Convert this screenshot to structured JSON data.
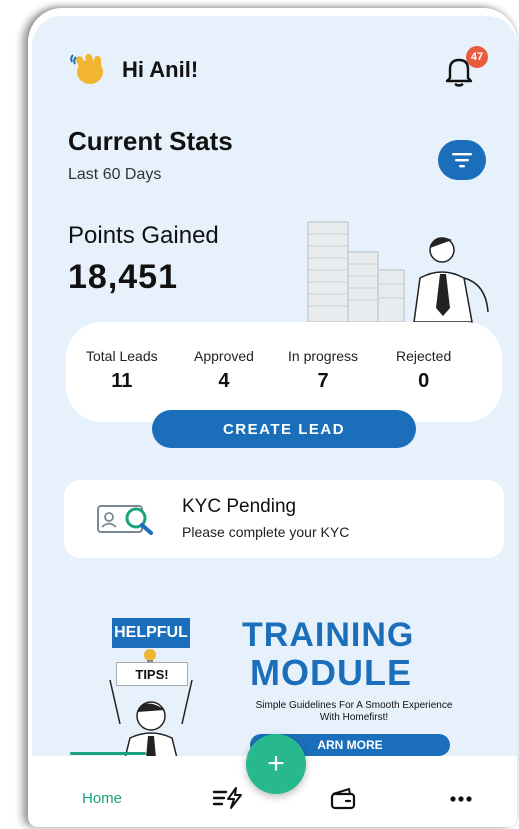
{
  "header": {
    "greeting": "Hi Anil!",
    "notification_count": "47"
  },
  "stats": {
    "title": "Current Stats",
    "period": "Last 60 Days",
    "points_label": "Points Gained",
    "points_value": "18,451",
    "items": [
      {
        "label": "Total Leads",
        "value": "11"
      },
      {
        "label": "Approved",
        "value": "4"
      },
      {
        "label": "In progress",
        "value": "7"
      },
      {
        "label": "Rejected",
        "value": "0"
      }
    ],
    "create_lead_label": "CREATE LEAD"
  },
  "kyc": {
    "title": "KYC Pending",
    "subtitle": "Please complete your KYC"
  },
  "banner": {
    "helpful": "HELPFUL",
    "tips": "TIPS!",
    "title_line1": "TRAINING",
    "title_line2": "MODULE",
    "subtitle": "Simple Guidelines For A Smooth Experience With Homefirst!",
    "button_label": "ARN MORE"
  },
  "nav": {
    "home_label": "Home",
    "fab_symbol": "+"
  },
  "colors": {
    "primary": "#1b6fba",
    "accent": "#27b88d",
    "background": "#e7f1fb",
    "badge": "#e85c3d"
  }
}
